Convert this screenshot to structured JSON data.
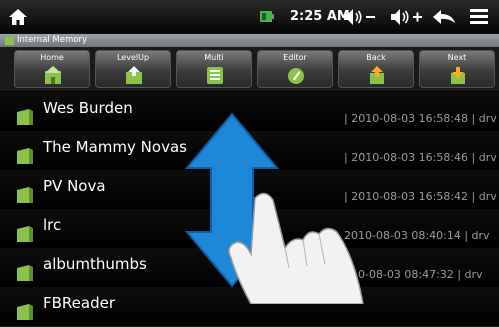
{
  "status": {
    "time": "2:25 AM",
    "vol_down_label": "−",
    "vol_up_label": "+"
  },
  "path": {
    "label": "Internal Memory"
  },
  "toolbar": [
    {
      "label": "Home",
      "icon": "home-folder-icon"
    },
    {
      "label": "LevelUp",
      "icon": "levelup-folder-icon"
    },
    {
      "label": "Multi",
      "icon": "multi-list-icon"
    },
    {
      "label": "Editor",
      "icon": "editor-disc-icon"
    },
    {
      "label": "Back",
      "icon": "back-arrow-icon"
    },
    {
      "label": "Next",
      "icon": "next-arrow-icon"
    }
  ],
  "files": [
    {
      "name": "Wes Burden",
      "meta": "| 2010-08-03 16:58:48 | drv"
    },
    {
      "name": "The Mammy Novas",
      "meta": "| 2010-08-03 16:58:46 | drv"
    },
    {
      "name": "PV Nova",
      "meta": "| 2010-08-03 16:58:42 | drv"
    },
    {
      "name": "lrc",
      "meta": "2010-08-03 08:40:14 | drv"
    },
    {
      "name": "albumthumbs",
      "meta": "010-08-03 08:47:32 | drv"
    },
    {
      "name": "FBReader",
      "meta": ""
    }
  ],
  "colors": {
    "accent_blue": "#1e88d8",
    "folder_green": "#8bc34a"
  }
}
